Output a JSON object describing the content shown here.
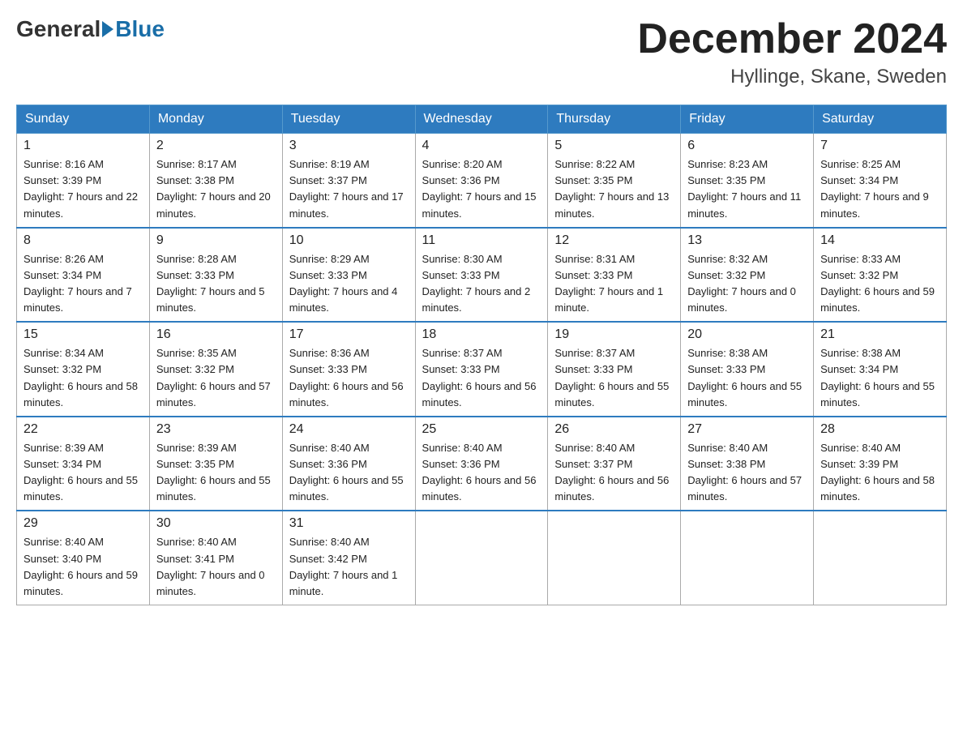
{
  "logo": {
    "general": "General",
    "blue": "Blue"
  },
  "title": {
    "month_year": "December 2024",
    "location": "Hyllinge, Skane, Sweden"
  },
  "weekdays": [
    "Sunday",
    "Monday",
    "Tuesday",
    "Wednesday",
    "Thursday",
    "Friday",
    "Saturday"
  ],
  "weeks": [
    [
      {
        "day": "1",
        "sunrise": "8:16 AM",
        "sunset": "3:39 PM",
        "daylight": "7 hours and 22 minutes."
      },
      {
        "day": "2",
        "sunrise": "8:17 AM",
        "sunset": "3:38 PM",
        "daylight": "7 hours and 20 minutes."
      },
      {
        "day": "3",
        "sunrise": "8:19 AM",
        "sunset": "3:37 PM",
        "daylight": "7 hours and 17 minutes."
      },
      {
        "day": "4",
        "sunrise": "8:20 AM",
        "sunset": "3:36 PM",
        "daylight": "7 hours and 15 minutes."
      },
      {
        "day": "5",
        "sunrise": "8:22 AM",
        "sunset": "3:35 PM",
        "daylight": "7 hours and 13 minutes."
      },
      {
        "day": "6",
        "sunrise": "8:23 AM",
        "sunset": "3:35 PM",
        "daylight": "7 hours and 11 minutes."
      },
      {
        "day": "7",
        "sunrise": "8:25 AM",
        "sunset": "3:34 PM",
        "daylight": "7 hours and 9 minutes."
      }
    ],
    [
      {
        "day": "8",
        "sunrise": "8:26 AM",
        "sunset": "3:34 PM",
        "daylight": "7 hours and 7 minutes."
      },
      {
        "day": "9",
        "sunrise": "8:28 AM",
        "sunset": "3:33 PM",
        "daylight": "7 hours and 5 minutes."
      },
      {
        "day": "10",
        "sunrise": "8:29 AM",
        "sunset": "3:33 PM",
        "daylight": "7 hours and 4 minutes."
      },
      {
        "day": "11",
        "sunrise": "8:30 AM",
        "sunset": "3:33 PM",
        "daylight": "7 hours and 2 minutes."
      },
      {
        "day": "12",
        "sunrise": "8:31 AM",
        "sunset": "3:33 PM",
        "daylight": "7 hours and 1 minute."
      },
      {
        "day": "13",
        "sunrise": "8:32 AM",
        "sunset": "3:32 PM",
        "daylight": "7 hours and 0 minutes."
      },
      {
        "day": "14",
        "sunrise": "8:33 AM",
        "sunset": "3:32 PM",
        "daylight": "6 hours and 59 minutes."
      }
    ],
    [
      {
        "day": "15",
        "sunrise": "8:34 AM",
        "sunset": "3:32 PM",
        "daylight": "6 hours and 58 minutes."
      },
      {
        "day": "16",
        "sunrise": "8:35 AM",
        "sunset": "3:32 PM",
        "daylight": "6 hours and 57 minutes."
      },
      {
        "day": "17",
        "sunrise": "8:36 AM",
        "sunset": "3:33 PM",
        "daylight": "6 hours and 56 minutes."
      },
      {
        "day": "18",
        "sunrise": "8:37 AM",
        "sunset": "3:33 PM",
        "daylight": "6 hours and 56 minutes."
      },
      {
        "day": "19",
        "sunrise": "8:37 AM",
        "sunset": "3:33 PM",
        "daylight": "6 hours and 55 minutes."
      },
      {
        "day": "20",
        "sunrise": "8:38 AM",
        "sunset": "3:33 PM",
        "daylight": "6 hours and 55 minutes."
      },
      {
        "day": "21",
        "sunrise": "8:38 AM",
        "sunset": "3:34 PM",
        "daylight": "6 hours and 55 minutes."
      }
    ],
    [
      {
        "day": "22",
        "sunrise": "8:39 AM",
        "sunset": "3:34 PM",
        "daylight": "6 hours and 55 minutes."
      },
      {
        "day": "23",
        "sunrise": "8:39 AM",
        "sunset": "3:35 PM",
        "daylight": "6 hours and 55 minutes."
      },
      {
        "day": "24",
        "sunrise": "8:40 AM",
        "sunset": "3:36 PM",
        "daylight": "6 hours and 55 minutes."
      },
      {
        "day": "25",
        "sunrise": "8:40 AM",
        "sunset": "3:36 PM",
        "daylight": "6 hours and 56 minutes."
      },
      {
        "day": "26",
        "sunrise": "8:40 AM",
        "sunset": "3:37 PM",
        "daylight": "6 hours and 56 minutes."
      },
      {
        "day": "27",
        "sunrise": "8:40 AM",
        "sunset": "3:38 PM",
        "daylight": "6 hours and 57 minutes."
      },
      {
        "day": "28",
        "sunrise": "8:40 AM",
        "sunset": "3:39 PM",
        "daylight": "6 hours and 58 minutes."
      }
    ],
    [
      {
        "day": "29",
        "sunrise": "8:40 AM",
        "sunset": "3:40 PM",
        "daylight": "6 hours and 59 minutes."
      },
      {
        "day": "30",
        "sunrise": "8:40 AM",
        "sunset": "3:41 PM",
        "daylight": "7 hours and 0 minutes."
      },
      {
        "day": "31",
        "sunrise": "8:40 AM",
        "sunset": "3:42 PM",
        "daylight": "7 hours and 1 minute."
      },
      null,
      null,
      null,
      null
    ]
  ]
}
